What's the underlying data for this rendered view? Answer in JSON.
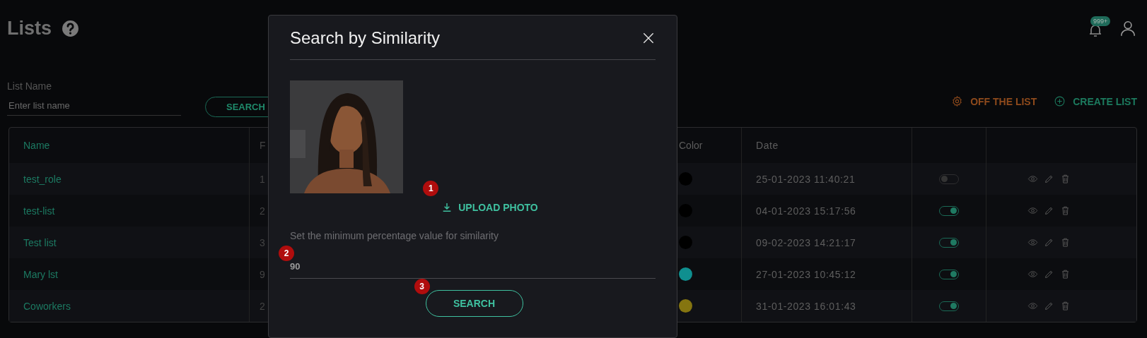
{
  "page": {
    "title": "Lists"
  },
  "header": {
    "notification_count": "999+"
  },
  "filter": {
    "label": "List Name",
    "placeholder": "Enter list name",
    "button": "SEARCH"
  },
  "actions": [
    {
      "kind": "off",
      "label": "OFF THE LIST"
    },
    {
      "kind": "create",
      "label": "CREATE LIST"
    }
  ],
  "table": {
    "columns": [
      "Name",
      "F",
      "Color",
      "Date"
    ],
    "rows": [
      {
        "name": "test_role",
        "column_2": "1",
        "color": "#000000",
        "date": "25-01-2023 11:40:21",
        "on": false
      },
      {
        "name": "test-list",
        "column_2": "2",
        "color": "#000000",
        "date": "04-01-2023 15:17:56",
        "on": true
      },
      {
        "name": "Test list",
        "column_2": "3",
        "color": "#000000",
        "date": "09-02-2023 14:21:17",
        "on": true
      },
      {
        "name": "Mary lst",
        "column_2": "9",
        "color": "#0f8f8f",
        "date": "27-01-2023 10:45:12",
        "on": true
      },
      {
        "name": "Coworkers",
        "column_2": "2",
        "color": "#857510",
        "date": "31-01-2023 16:01:43",
        "on": true
      }
    ]
  },
  "modal": {
    "title": "Search by Similarity",
    "photo": {
      "kind": "picture"
    },
    "upload": "UPLOAD PHOTO",
    "hint": "Set the minimum percentage value for similarity",
    "value": "90",
    "button": "SEARCH",
    "markers": [
      "1",
      "2",
      "3"
    ]
  }
}
